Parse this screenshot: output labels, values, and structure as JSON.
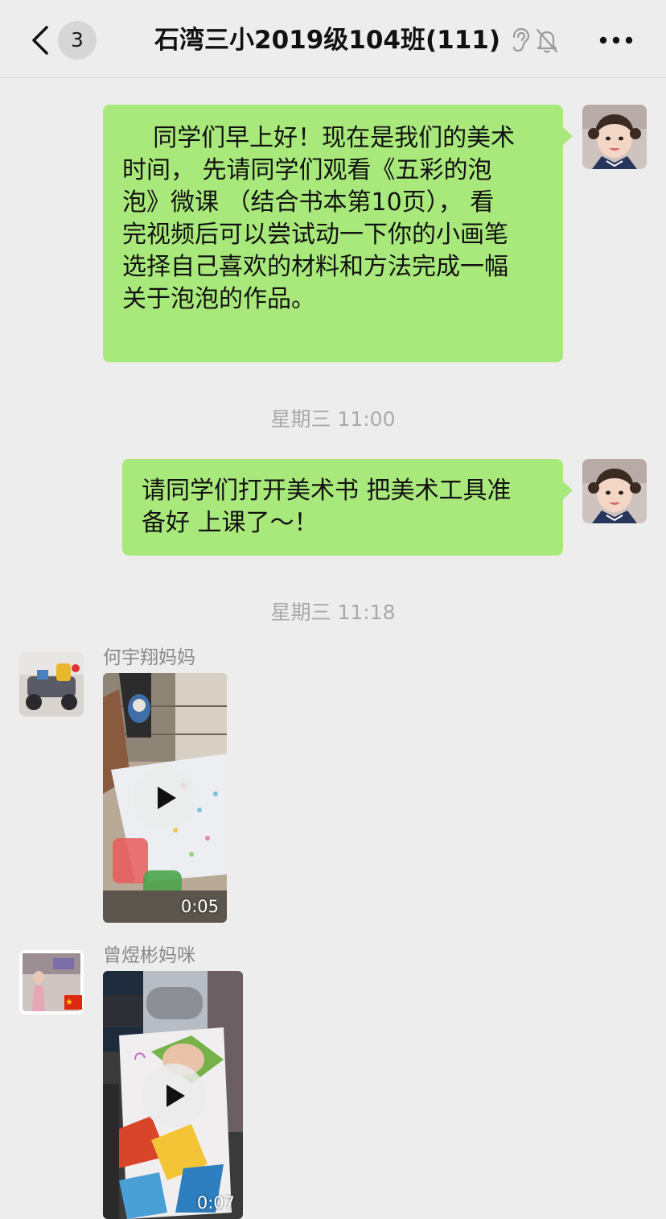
{
  "header": {
    "unread_count": "3",
    "title": "石湾三小2019级104班(111)",
    "icons": [
      "back-icon",
      "ear-icon",
      "mute-bell-icon",
      "more-icon"
    ]
  },
  "messages": {
    "msg1": {
      "text": "    同学们早上好！现在是我们的美术\n时间， 先请同学们观看《五彩的泡\n泡》微课 （结合书本第10页）， 看\n完视频后可以尝试动一下你的小画笔\n选择自己喜欢的材料和方法完成一幅\n关于泡泡的作品。"
    },
    "time1": "星期三 11:00",
    "msg2": {
      "text": "请同学们打开美术书 把美术工具准\n备好 上课了～！"
    },
    "time2": "星期三 11:18",
    "msg3": {
      "sender": "何宇翔妈妈",
      "video_duration": "0:05"
    },
    "msg4": {
      "sender": "曾煜彬妈咪",
      "video_duration": "0:07"
    }
  },
  "colors": {
    "background": "#ededed",
    "outgoing_bubble": "#a9e97b",
    "timestamp_text": "#a9a9a9",
    "sender_text": "#8a8a8a"
  }
}
